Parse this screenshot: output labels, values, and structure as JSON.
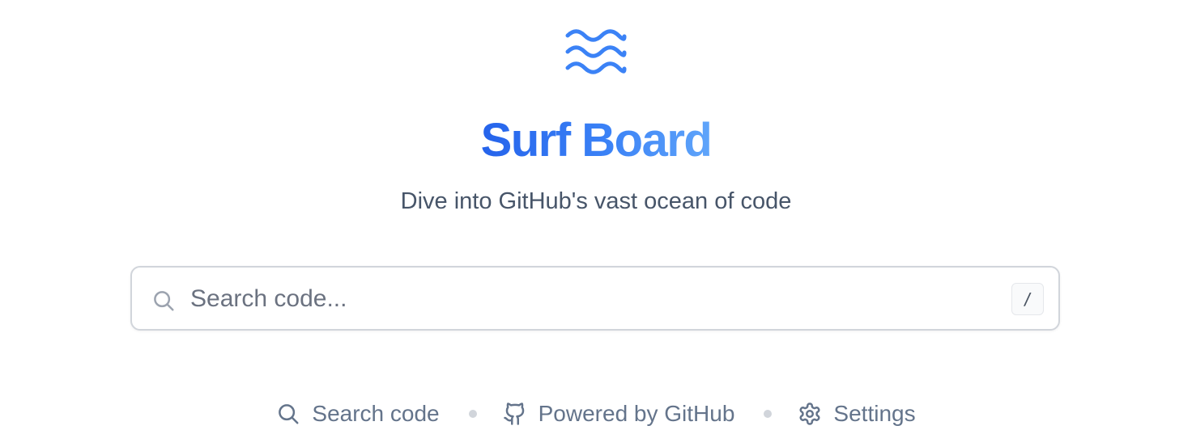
{
  "app": {
    "title": "Surf Board",
    "subtitle": "Dive into GitHub's vast ocean of code",
    "logo_icon": "waves-icon",
    "accent_color": "#3b82f6"
  },
  "search": {
    "placeholder": "Search code...",
    "value": "",
    "shortcut_key": "/",
    "icon": "search-icon"
  },
  "footer": {
    "items": [
      {
        "label": "Search code",
        "icon": "search-icon"
      },
      {
        "label": "Powered by GitHub",
        "icon": "github-icon"
      },
      {
        "label": "Settings",
        "icon": "gear-icon"
      }
    ]
  }
}
